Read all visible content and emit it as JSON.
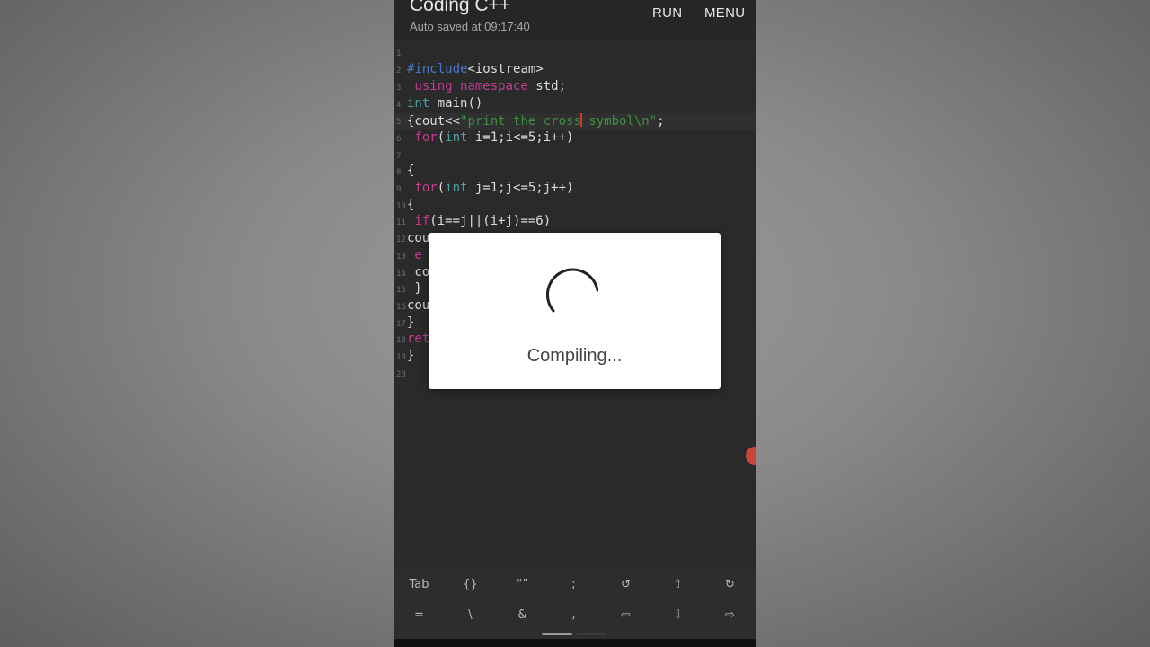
{
  "app": {
    "title": "Coding C++",
    "subtitle": "Auto saved at 09:17:40",
    "run_label": "RUN",
    "menu_label": "MENU"
  },
  "editor": {
    "lines": [
      {
        "n": "1",
        "parts": []
      },
      {
        "n": "2",
        "parts": [
          {
            "t": "#include",
            "c": "kw-blue"
          },
          {
            "t": "<iostream>",
            "c": ""
          }
        ]
      },
      {
        "n": "3",
        "parts": [
          {
            "t": " using",
            "c": "kw-pink"
          },
          {
            "t": " namespace",
            "c": "kw-pink"
          },
          {
            "t": " std;",
            "c": ""
          }
        ]
      },
      {
        "n": "4",
        "parts": [
          {
            "t": "int",
            "c": "kw-teal"
          },
          {
            "t": " main()",
            "c": ""
          }
        ]
      },
      {
        "n": "5",
        "parts": [
          {
            "t": "{cout<<",
            "c": ""
          },
          {
            "t": "\"print the cross",
            "c": "str"
          },
          {
            "t": "|",
            "c": "caret"
          },
          {
            "t": " symbol\\n\"",
            "c": "str"
          },
          {
            "t": ";",
            "c": ""
          }
        ]
      },
      {
        "n": "6",
        "parts": [
          {
            "t": " for",
            "c": "kw-pink"
          },
          {
            "t": "(",
            "c": ""
          },
          {
            "t": "int",
            "c": "kw-teal"
          },
          {
            "t": " i=1;i<=5;i++)",
            "c": ""
          }
        ]
      },
      {
        "n": "7",
        "parts": []
      },
      {
        "n": "8",
        "parts": [
          {
            "t": "{",
            "c": ""
          }
        ]
      },
      {
        "n": "9",
        "parts": [
          {
            "t": " for",
            "c": "kw-pink"
          },
          {
            "t": "(",
            "c": ""
          },
          {
            "t": "int",
            "c": "kw-teal"
          },
          {
            "t": " j=1;j<=5;j++)",
            "c": ""
          }
        ]
      },
      {
        "n": "10",
        "parts": [
          {
            "t": "{",
            "c": ""
          }
        ]
      },
      {
        "n": "11",
        "parts": [
          {
            "t": " if",
            "c": "kw-pink"
          },
          {
            "t": "(i==j||(i+j)==6)",
            "c": ""
          }
        ]
      },
      {
        "n": "12",
        "parts": [
          {
            "t": "cout",
            "c": ""
          }
        ]
      },
      {
        "n": "13",
        "parts": [
          {
            "t": " e",
            "c": "kw-pink"
          }
        ]
      },
      {
        "n": "14",
        "parts": [
          {
            "t": " co",
            "c": ""
          }
        ]
      },
      {
        "n": "15",
        "parts": [
          {
            "t": " }",
            "c": ""
          }
        ]
      },
      {
        "n": "16",
        "parts": [
          {
            "t": "cou",
            "c": ""
          }
        ]
      },
      {
        "n": "17",
        "parts": [
          {
            "t": "}",
            "c": ""
          }
        ]
      },
      {
        "n": "18",
        "parts": [
          {
            "t": "ret",
            "c": "kw-pink"
          }
        ]
      },
      {
        "n": "19",
        "parts": [
          {
            "t": "}",
            "c": ""
          }
        ]
      },
      {
        "n": "20",
        "parts": []
      }
    ],
    "active_line": 4
  },
  "dialog": {
    "message": "Compiling..."
  },
  "keyboard": {
    "row1": [
      "Tab",
      "{}",
      "“”",
      ";",
      "↺",
      "⇧",
      "↻"
    ],
    "row2": [
      "=",
      "\\",
      "&",
      ",",
      "⇦",
      "⇩",
      "⇨"
    ]
  },
  "colors": {
    "editor_bg": "#2a2a2a",
    "keyword_blue": "#4a79c9",
    "keyword_pink": "#c23d8e",
    "keyword_teal": "#4fa3a3",
    "string_green": "#3f8f3f",
    "caret_red": "#dd3333"
  }
}
